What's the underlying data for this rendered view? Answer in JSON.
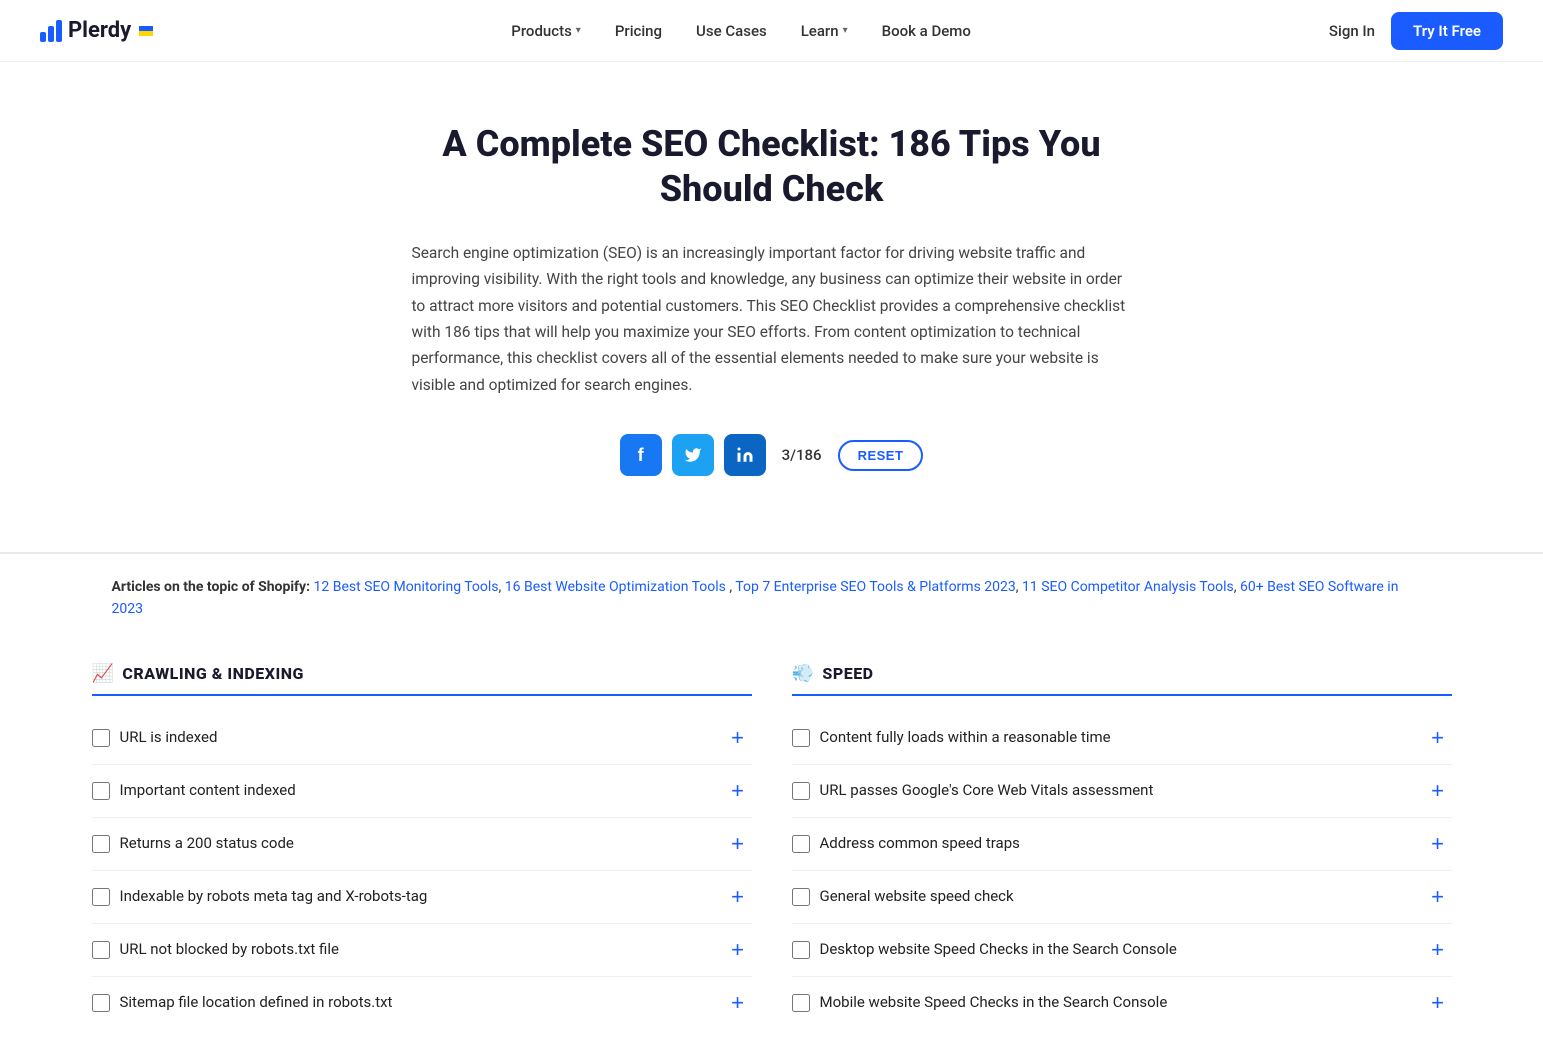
{
  "navbar": {
    "logo_text": "Plerdy",
    "links": [
      {
        "label": "Products",
        "has_dropdown": true
      },
      {
        "label": "Pricing",
        "has_dropdown": false
      },
      {
        "label": "Use Cases",
        "has_dropdown": false
      },
      {
        "label": "Learn",
        "has_dropdown": true
      },
      {
        "label": "Book a Demo",
        "has_dropdown": false
      }
    ],
    "signin_label": "Sign In",
    "try_free_label": "Try It Free"
  },
  "hero": {
    "title": "A Complete SEO Checklist: 186 Tips You Should Check",
    "description": "Search engine optimization (SEO) is an increasingly important factor for driving website traffic and improving visibility. With the right tools and knowledge, any business can optimize their website in order to attract more visitors and potential customers. This SEO Checklist provides a comprehensive checklist with 186 tips that will help you maximize your SEO efforts. From content optimization to technical performance, this checklist covers all of the essential elements needed to make sure your website is visible and optimized for search engines."
  },
  "social": {
    "facebook_label": "f",
    "twitter_label": "t",
    "linkedin_label": "in",
    "counter_text": "3/186",
    "reset_label": "RESET"
  },
  "articles": {
    "prefix": "Articles on the topic of Shopify:",
    "links": [
      "12 Best SEO Monitoring Tools",
      "16 Best Website Optimization Tools",
      "Top 7 Enterprise SEO Tools & Platforms 2023",
      "11 SEO Competitor Analysis Tools",
      "60+ Best SEO Software in 2023"
    ]
  },
  "crawling_section": {
    "header": "CRAWLING & INDEXING",
    "header_icon": "📈",
    "items": [
      "URL is indexed",
      "Important content indexed",
      "Returns a 200 status code",
      "Indexable by robots meta tag and X-robots-tag",
      "URL not blocked by robots.txt file",
      "Sitemap file location defined in robots.txt"
    ]
  },
  "speed_section": {
    "header": "SPEED",
    "header_icon": "💨",
    "items": [
      "Content fully loads within a reasonable time",
      "URL passes Google's Core Web Vitals assessment",
      "Address common speed traps",
      "General website speed check",
      "Desktop website Speed Checks in the Search Console",
      "Mobile website Speed Checks in the Search Console"
    ]
  }
}
